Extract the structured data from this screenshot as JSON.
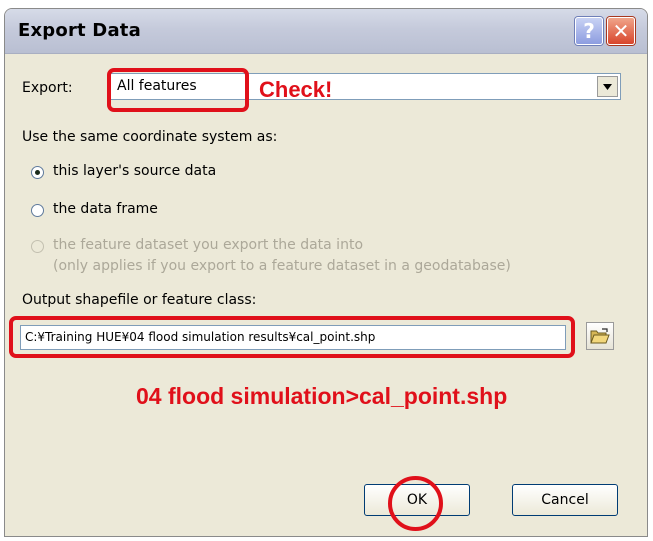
{
  "window": {
    "title": "Export Data"
  },
  "titlebar": {
    "help_glyph": "?",
    "close_glyph": "✕"
  },
  "export": {
    "label": "Export:",
    "selected": "All features"
  },
  "coord": {
    "heading": "Use the same coordinate system as:",
    "options": [
      {
        "label": "this layer's source data",
        "checked": true,
        "enabled": true
      },
      {
        "label": "the data frame",
        "checked": false,
        "enabled": true
      },
      {
        "label": "the feature dataset you export the data into",
        "checked": false,
        "enabled": false
      }
    ],
    "option3_note": "(only applies if you export to a feature dataset in a geodatabase)"
  },
  "output": {
    "label": "Output shapefile or feature class:",
    "value": "C:¥Training HUE¥04 flood simulation results¥cal_point.shp"
  },
  "buttons": {
    "ok": "OK",
    "cancel": "Cancel"
  },
  "annotations": {
    "check": "Check!",
    "hint": "04 flood simulation>cal_point.shp",
    "color": "#e0101a"
  },
  "icons": {
    "browse": "open-folder-icon",
    "dropdown": "triangle-down-icon"
  }
}
